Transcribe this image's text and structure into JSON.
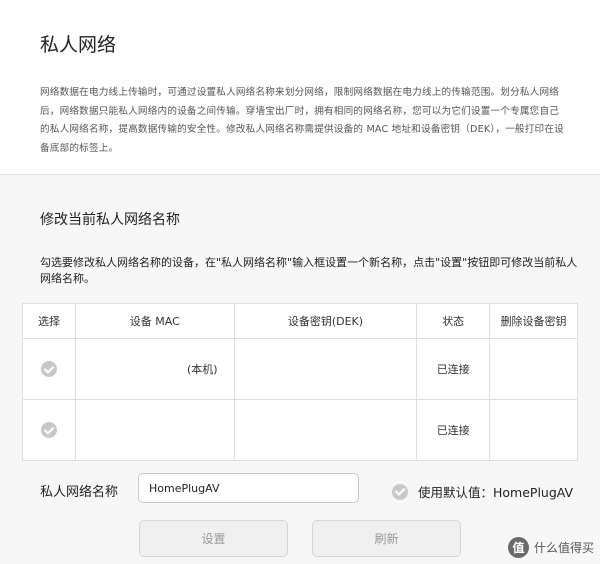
{
  "page": {
    "title": "私人网络",
    "description": "网络数据在电力线上传输时，可通过设置私人网络名称来划分网络，限制网络数据在电力线上的传输范围。划分私人网络后，网络数据只能私人网络内的设备之间传输。穿墙宝出厂时，拥有相同的网络名称，您可以为它们设置一个专属您自己的私人网络名称，提高数据传输的安全性。修改私人网络名称需提供设备的 MAC 地址和设备密钥（DEK），一般打印在设备底部的标签上。"
  },
  "modify_section": {
    "title": "修改当前私人网络名称",
    "instructions": "勾选要修改私人网络名称的设备，在\"私人网络名称\"输入框设置一个新名称，点击\"设置\"按钮即可修改当前私人网络名称。"
  },
  "table": {
    "headers": {
      "select": "选择",
      "mac": "设备 MAC",
      "dek": "设备密钥(DEK)",
      "status": "状态",
      "delete_key": "删除设备密钥"
    },
    "rows": [
      {
        "mac": "(本机)",
        "dek": "",
        "status": "已连接"
      },
      {
        "mac": "",
        "dek": "",
        "status": "已连接"
      }
    ]
  },
  "network_name": {
    "label": "私人网络名称",
    "value": "HomePlugAV",
    "default_label": "使用默认值：HomePlugAV"
  },
  "buttons": {
    "set": "设置",
    "refresh": "刷新"
  },
  "watermark": {
    "logo": "值",
    "text": "什么值得买"
  }
}
